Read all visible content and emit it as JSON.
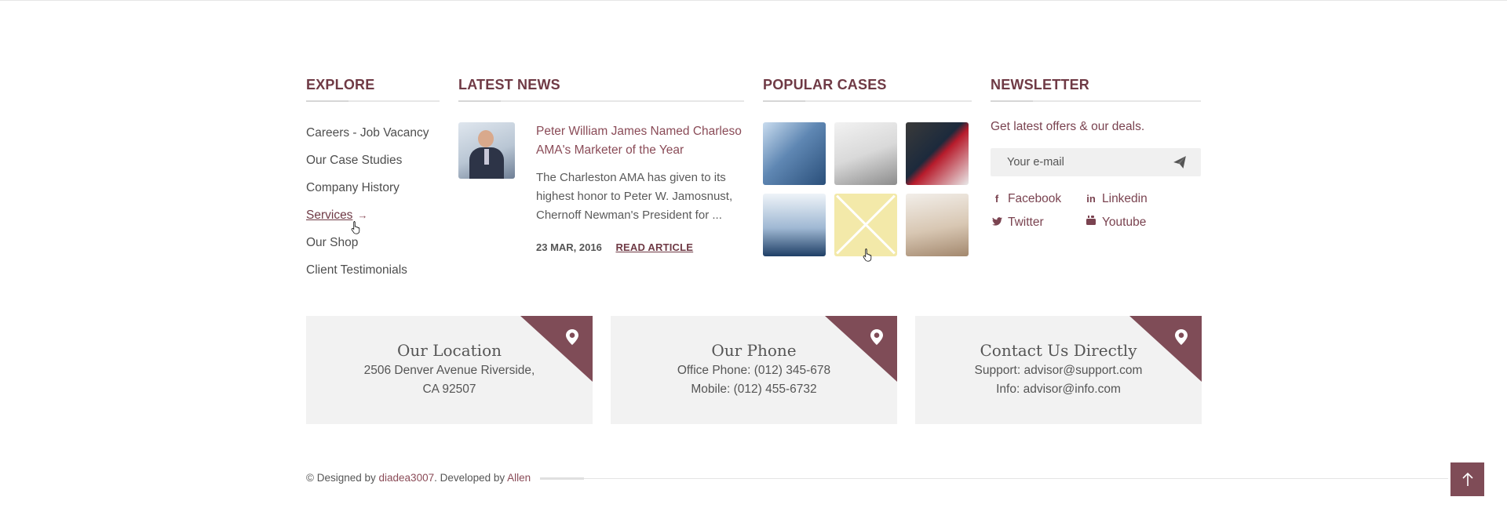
{
  "explore": {
    "heading": "EXPLORE",
    "items": [
      {
        "label": "Careers - Job Vacancy"
      },
      {
        "label": "Our Case Studies"
      },
      {
        "label": "Company History"
      },
      {
        "label": "Services",
        "arrow": "→"
      },
      {
        "label": "Our Shop"
      },
      {
        "label": "Client Testimonials"
      }
    ]
  },
  "news": {
    "heading": "LATEST NEWS",
    "title": "Peter William James Named Charleso AMA's Marketer of the Year",
    "excerpt": "The Charleston AMA has given to its highest honor to Peter W. Jamosnust, Chernoff Newman's President for ...",
    "date": "23 MAR, 2016",
    "read_label": "READ ARTICLE"
  },
  "cases": {
    "heading": "POPULAR CASES"
  },
  "newsletter": {
    "heading": "NEWSLETTER",
    "text": "Get latest offers & our deals.",
    "placeholder": "Your e-mail",
    "send_icon": "paper-plane-icon",
    "socials": [
      {
        "label": "Facebook",
        "icon": "facebook-icon"
      },
      {
        "label": "Linkedin",
        "icon": "linkedin-icon"
      },
      {
        "label": "Twitter",
        "icon": "twitter-icon"
      },
      {
        "label": "Youtube",
        "icon": "youtube-icon"
      }
    ]
  },
  "contacts": {
    "location": {
      "title": "Our Location",
      "lines": [
        "2506 Denver Avenue Riverside,",
        "CA 92507"
      ]
    },
    "phone": {
      "title": "Our Phone",
      "lines": [
        "Office Phone: (012) 345-678",
        "Mobile: (012) 455-6732"
      ]
    },
    "contact": {
      "title": "Contact Us Directly",
      "lines": [
        "Support: advisor@support.com",
        "Info: advisor@info.com"
      ]
    }
  },
  "footer": {
    "prefix": "© Designed by",
    "designer": "diadea3007",
    "middle": ". Developed by",
    "developer": "Allen"
  },
  "colors": {
    "accent": "#7f4c57",
    "heading": "#6f3a45",
    "box_bg": "#f2f2f2"
  }
}
